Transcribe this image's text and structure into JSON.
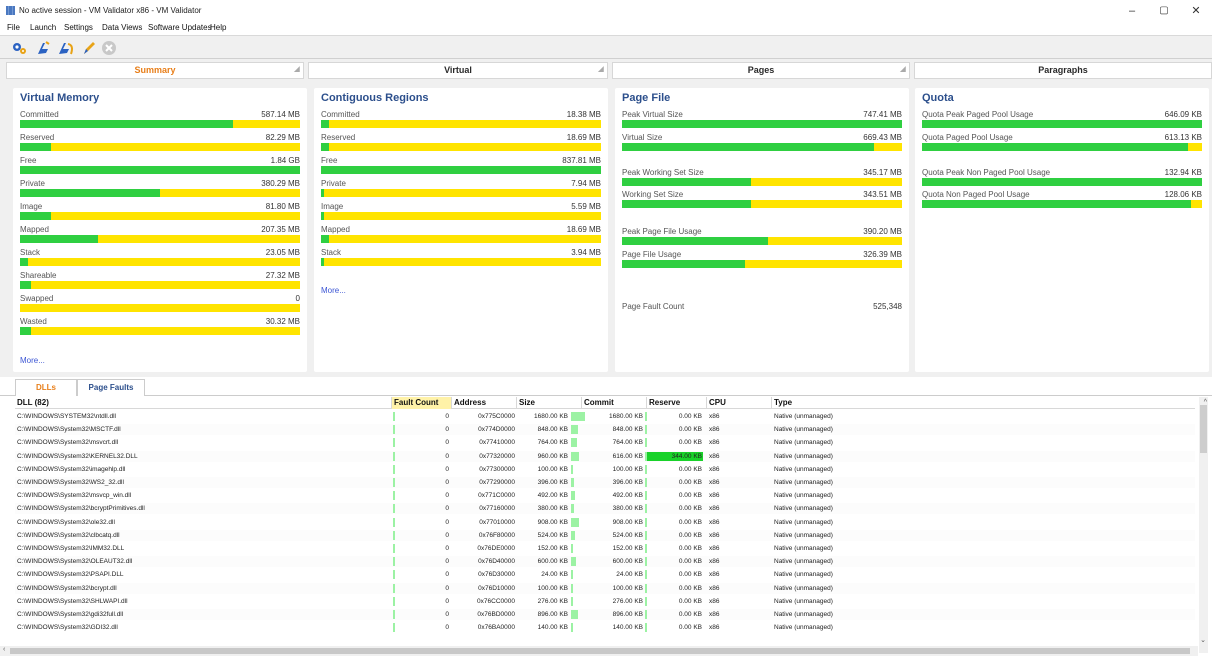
{
  "window": {
    "title": "No active session - VM Validator x86 - VM Validator",
    "minimize": "–",
    "maximize": "▢",
    "close": "✕"
  },
  "menu": [
    "File",
    "Launch",
    "Settings",
    "Data Views",
    "Software Updates",
    "Help"
  ],
  "toolbar": {
    "icons": [
      "settings-icon",
      "launch-icon",
      "launch-with-options-icon",
      "edit-icon",
      "stop-icon"
    ]
  },
  "pane_tabs": [
    "Summary",
    "Virtual",
    "Pages",
    "Paragraphs"
  ],
  "virtual_memory": {
    "title": "Virtual Memory",
    "more": "More...",
    "rows": [
      {
        "label": "Committed",
        "value": "587.14 MB",
        "fraction": 0.76
      },
      {
        "label": "Reserved",
        "value": "82.29 MB",
        "fraction": 0.11
      },
      {
        "label": "Free",
        "value": "1.84 GB",
        "fraction": 1.0
      },
      {
        "label": "Private",
        "value": "380.29 MB",
        "fraction": 0.5
      },
      {
        "label": "Image",
        "value": "81.80 MB",
        "fraction": 0.11
      },
      {
        "label": "Mapped",
        "value": "207.35 MB",
        "fraction": 0.28
      },
      {
        "label": "Stack",
        "value": "23.05 MB",
        "fraction": 0.03
      },
      {
        "label": "Shareable",
        "value": "27.32 MB",
        "fraction": 0.04
      },
      {
        "label": "Swapped",
        "value": "0",
        "fraction": 0
      },
      {
        "label": "Wasted",
        "value": "30.32 MB",
        "fraction": 0.04
      }
    ]
  },
  "contiguous_regions": {
    "title": "Contiguous Regions",
    "more": "More...",
    "rows": [
      {
        "label": "Committed",
        "value": "18.38 MB",
        "fraction": 0.03
      },
      {
        "label": "Reserved",
        "value": "18.69 MB",
        "fraction": 0.03
      },
      {
        "label": "Free",
        "value": "837.81 MB",
        "fraction": 1.0
      },
      {
        "label": "Private",
        "value": "7.94 MB",
        "fraction": 0.01
      },
      {
        "label": "Image",
        "value": "5.59 MB",
        "fraction": 0.01
      },
      {
        "label": "Mapped",
        "value": "18.69 MB",
        "fraction": 0.03
      },
      {
        "label": "Stack",
        "value": "3.94 MB",
        "fraction": 0.01
      }
    ]
  },
  "page_file": {
    "title": "Page File",
    "rows": [
      {
        "label": "Peak Virtual Size",
        "value": "747.41 MB",
        "fraction": 1.0
      },
      {
        "label": "Virtual Size",
        "value": "669.43 MB",
        "fraction": 0.9
      },
      {
        "label": "Peak Working Set Size",
        "value": "345.17 MB",
        "fraction": 0.46
      },
      {
        "label": "Working Set Size",
        "value": "343.51 MB",
        "fraction": 0.46
      },
      {
        "label": "Peak Page File Usage",
        "value": "390.20 MB",
        "fraction": 0.52
      },
      {
        "label": "Page File Usage",
        "value": "326.39 MB",
        "fraction": 0.44
      }
    ],
    "fault_label": "Page Fault Count",
    "fault_value": "525,348"
  },
  "quota": {
    "title": "Quota",
    "rows": [
      {
        "label": "Quota Peak Paged Pool Usage",
        "value": "646.09 KB",
        "fraction": 1.0
      },
      {
        "label": "Quota Paged Pool Usage",
        "value": "613.13 KB",
        "fraction": 0.95
      },
      {
        "label": "Quota Peak Non Paged Pool Usage",
        "value": "132.94 KB",
        "fraction": 1.0
      },
      {
        "label": "Quota Non Paged Pool Usage",
        "value": "128.06 KB",
        "fraction": 0.96
      }
    ]
  },
  "bottom_tabs": [
    "DLLs",
    "Page Faults"
  ],
  "grid": {
    "columns": [
      "DLL (82)",
      "Fault Count",
      "Address",
      "Size",
      "Commit",
      "Reserve",
      "CPU",
      "Type"
    ],
    "rows": [
      {
        "dll": "C:\\WINDOWS\\SYSTEM32\\ntdll.dll",
        "fault": "0",
        "address": "0x775C0000",
        "size": "1680.00 KB",
        "size_frac": 1.0,
        "commit": "1680.00 KB",
        "reserve": "0.00 KB",
        "reserve_frac": 0,
        "cpu": "x86",
        "type": "Native (unmanaged)"
      },
      {
        "dll": "C:\\WINDOWS\\System32\\MSCTF.dll",
        "fault": "0",
        "address": "0x774D0000",
        "size": "848.00 KB",
        "size_frac": 0.5,
        "commit": "848.00 KB",
        "reserve": "0.00 KB",
        "reserve_frac": 0,
        "cpu": "x86",
        "type": "Native (unmanaged)"
      },
      {
        "dll": "C:\\WINDOWS\\System32\\msvcrt.dll",
        "fault": "0",
        "address": "0x77410000",
        "size": "764.00 KB",
        "size_frac": 0.45,
        "commit": "764.00 KB",
        "reserve": "0.00 KB",
        "reserve_frac": 0,
        "cpu": "x86",
        "type": "Native (unmanaged)"
      },
      {
        "dll": "C:\\WINDOWS\\System32\\KERNEL32.DLL",
        "fault": "0",
        "address": "0x77320000",
        "size": "960.00 KB",
        "size_frac": 0.57,
        "commit": "616.00 KB",
        "reserve": "344.00 KB",
        "reserve_frac": 1.0,
        "cpu": "x86",
        "type": "Native (unmanaged)"
      },
      {
        "dll": "C:\\WINDOWS\\System32\\imagehlp.dll",
        "fault": "0",
        "address": "0x77300000",
        "size": "100.00 KB",
        "size_frac": 0.06,
        "commit": "100.00 KB",
        "reserve": "0.00 KB",
        "reserve_frac": 0,
        "cpu": "x86",
        "type": "Native (unmanaged)"
      },
      {
        "dll": "C:\\WINDOWS\\System32\\WS2_32.dll",
        "fault": "0",
        "address": "0x77290000",
        "size": "396.00 KB",
        "size_frac": 0.24,
        "commit": "396.00 KB",
        "reserve": "0.00 KB",
        "reserve_frac": 0,
        "cpu": "x86",
        "type": "Native (unmanaged)"
      },
      {
        "dll": "C:\\WINDOWS\\System32\\msvcp_win.dll",
        "fault": "0",
        "address": "0x771C0000",
        "size": "492.00 KB",
        "size_frac": 0.29,
        "commit": "492.00 KB",
        "reserve": "0.00 KB",
        "reserve_frac": 0,
        "cpu": "x86",
        "type": "Native (unmanaged)"
      },
      {
        "dll": "C:\\WINDOWS\\System32\\bcryptPrimitives.dll",
        "fault": "0",
        "address": "0x77160000",
        "size": "380.00 KB",
        "size_frac": 0.23,
        "commit": "380.00 KB",
        "reserve": "0.00 KB",
        "reserve_frac": 0,
        "cpu": "x86",
        "type": "Native (unmanaged)"
      },
      {
        "dll": "C:\\WINDOWS\\System32\\ole32.dll",
        "fault": "0",
        "address": "0x77010000",
        "size": "908.00 KB",
        "size_frac": 0.54,
        "commit": "908.00 KB",
        "reserve": "0.00 KB",
        "reserve_frac": 0,
        "cpu": "x86",
        "type": "Native (unmanaged)"
      },
      {
        "dll": "C:\\WINDOWS\\System32\\clbcatq.dll",
        "fault": "0",
        "address": "0x76F80000",
        "size": "524.00 KB",
        "size_frac": 0.31,
        "commit": "524.00 KB",
        "reserve": "0.00 KB",
        "reserve_frac": 0,
        "cpu": "x86",
        "type": "Native (unmanaged)"
      },
      {
        "dll": "C:\\WINDOWS\\System32\\IMM32.DLL",
        "fault": "0",
        "address": "0x76DE0000",
        "size": "152.00 KB",
        "size_frac": 0.09,
        "commit": "152.00 KB",
        "reserve": "0.00 KB",
        "reserve_frac": 0,
        "cpu": "x86",
        "type": "Native (unmanaged)"
      },
      {
        "dll": "C:\\WINDOWS\\System32\\OLEAUT32.dll",
        "fault": "0",
        "address": "0x76D40000",
        "size": "600.00 KB",
        "size_frac": 0.36,
        "commit": "600.00 KB",
        "reserve": "0.00 KB",
        "reserve_frac": 0,
        "cpu": "x86",
        "type": "Native (unmanaged)"
      },
      {
        "dll": "C:\\WINDOWS\\System32\\PSAPI.DLL",
        "fault": "0",
        "address": "0x76D30000",
        "size": "24.00 KB",
        "size_frac": 0.02,
        "commit": "24.00 KB",
        "reserve": "0.00 KB",
        "reserve_frac": 0,
        "cpu": "x86",
        "type": "Native (unmanaged)"
      },
      {
        "dll": "C:\\WINDOWS\\System32\\bcrypt.dll",
        "fault": "0",
        "address": "0x76D10000",
        "size": "100.00 KB",
        "size_frac": 0.06,
        "commit": "100.00 KB",
        "reserve": "0.00 KB",
        "reserve_frac": 0,
        "cpu": "x86",
        "type": "Native (unmanaged)"
      },
      {
        "dll": "C:\\WINDOWS\\System32\\SHLWAPI.dll",
        "fault": "0",
        "address": "0x76CC0000",
        "size": "276.00 KB",
        "size_frac": 0.16,
        "commit": "276.00 KB",
        "reserve": "0.00 KB",
        "reserve_frac": 0,
        "cpu": "x86",
        "type": "Native (unmanaged)"
      },
      {
        "dll": "C:\\WINDOWS\\System32\\gdi32full.dll",
        "fault": "0",
        "address": "0x76BD0000",
        "size": "896.00 KB",
        "size_frac": 0.53,
        "commit": "896.00 KB",
        "reserve": "0.00 KB",
        "reserve_frac": 0,
        "cpu": "x86",
        "type": "Native (unmanaged)"
      },
      {
        "dll": "C:\\WINDOWS\\System32\\GDI32.dll",
        "fault": "0",
        "address": "0x76BA0000",
        "size": "140.00 KB",
        "size_frac": 0.08,
        "commit": "140.00 KB",
        "reserve": "0.00 KB",
        "reserve_frac": 0,
        "cpu": "x86",
        "type": "Native (unmanaged)"
      }
    ]
  },
  "colors": {
    "accent": "#e87f1a",
    "title_blue": "#2c4f8c",
    "bar_green": "#2fcf41",
    "bar_yellow": "#ffe400"
  }
}
